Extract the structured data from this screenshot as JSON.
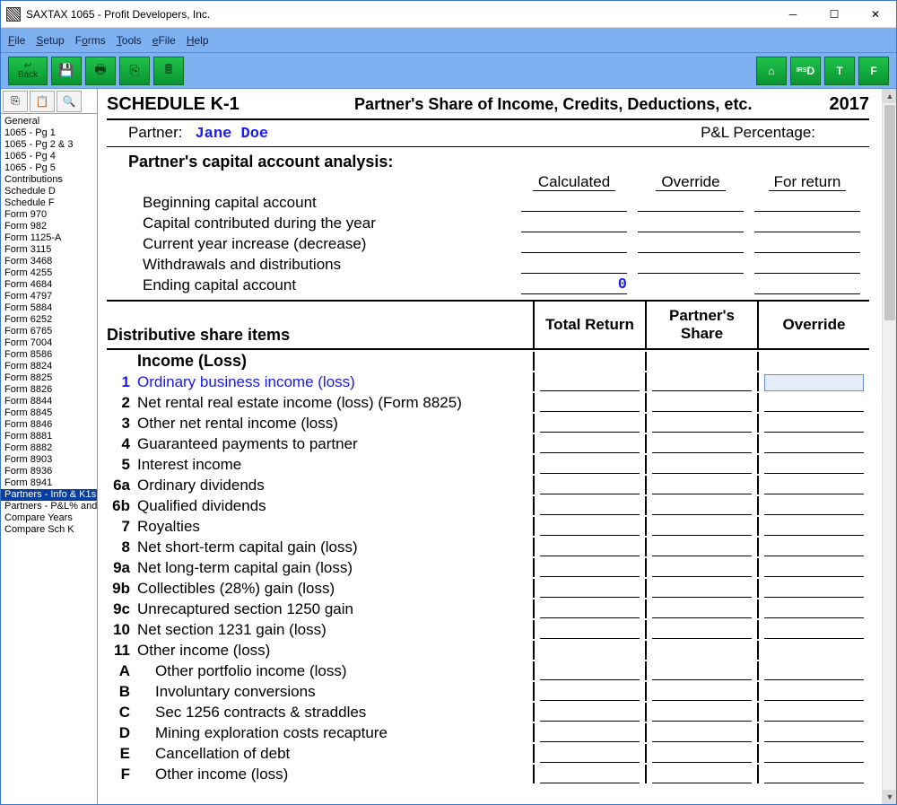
{
  "window": {
    "title": "SAXTAX 1065 - Profit Developers, Inc."
  },
  "menu": {
    "file": "File",
    "setup": "Setup",
    "forms": "Forms",
    "tools": "Tools",
    "efile": "eFile",
    "help": "Help"
  },
  "toolbar": {
    "back": "Back"
  },
  "irs": {
    "home": "⌂",
    "d": "D",
    "t": "T",
    "f": "F",
    "irs": "IRS"
  },
  "sidebar": {
    "items": [
      "General",
      "1065 - Pg 1",
      "1065 - Pg 2 & 3",
      "1065 - Pg 4",
      "1065 - Pg 5",
      "Contributions",
      "Schedule D",
      "Schedule F",
      "Form 970",
      "Form 982",
      "Form 1125-A",
      "Form 3115",
      "Form 3468",
      "Form 4255",
      "Form 4684",
      "Form 4797",
      "Form 5884",
      "Form 6252",
      "Form 6765",
      "Form 7004",
      "Form 8586",
      "Form 8824",
      "Form 8825",
      "Form 8826",
      "Form 8844",
      "Form 8845",
      "Form 8846",
      "Form 8881",
      "Form 8882",
      "Form 8903",
      "Form 8936",
      "Form 8941",
      "Partners - Info & K1s",
      "Partners - P&L% and",
      "Compare Years",
      "Compare Sch K"
    ],
    "selectedIndex": 32
  },
  "form": {
    "schedule": "SCHEDULE K-1",
    "subtitle": "Partner's Share of Income, Credits, Deductions, etc.",
    "year": "2017",
    "partner_label": "Partner:",
    "partner_name": "Jane Doe",
    "pl_pct_label": "P&L Percentage:",
    "cap_title": "Partner's capital account analysis:",
    "cap_cols": {
      "c1": "Calculated",
      "c2": "Override",
      "c3": "For return"
    },
    "cap_rows": {
      "r1": "Beginning capital account",
      "r2": "Capital contributed during the year",
      "r3": "Current year increase (decrease)",
      "r4": "Withdrawals and distributions",
      "r5": "Ending capital account"
    },
    "cap_vals": {
      "ending_calc": "0"
    },
    "dist_title": "Distributive share items",
    "dist_cols": {
      "c1": "Total Return",
      "c2": "Partner's Share",
      "c3": "Override"
    },
    "income_heading": "Income (Loss)",
    "lines": {
      "l1": {
        "n": "1",
        "t": "Ordinary business income (loss)"
      },
      "l2": {
        "n": "2",
        "t": "Net rental real estate income (loss) (Form 8825)"
      },
      "l3": {
        "n": "3",
        "t": "Other net rental income (loss)"
      },
      "l4": {
        "n": "4",
        "t": "Guaranteed payments to partner"
      },
      "l5": {
        "n": "5",
        "t": "Interest income"
      },
      "l6a": {
        "n": "6a",
        "t": "Ordinary dividends"
      },
      "l6b": {
        "n": "6b",
        "t": "Qualified dividends"
      },
      "l7": {
        "n": "7",
        "t": "Royalties"
      },
      "l8": {
        "n": "8",
        "t": "Net short-term capital gain (loss)"
      },
      "l9a": {
        "n": "9a",
        "t": "Net long-term capital gain (loss)"
      },
      "l9b": {
        "n": "9b",
        "t": "Collectibles (28%) gain (loss)"
      },
      "l9c": {
        "n": "9c",
        "t": "Unrecaptured section 1250 gain"
      },
      "l10": {
        "n": "10",
        "t": "Net section 1231 gain (loss)"
      },
      "l11": {
        "n": "11",
        "t": "Other income (loss)"
      },
      "l11a": {
        "n": "A",
        "t": "Other portfolio income (loss)"
      },
      "l11b": {
        "n": "B",
        "t": "Involuntary conversions"
      },
      "l11c": {
        "n": "C",
        "t": "Sec 1256 contracts & straddles"
      },
      "l11d": {
        "n": "D",
        "t": "Mining exploration costs recapture"
      },
      "l11e": {
        "n": "E",
        "t": "Cancellation of debt"
      },
      "l11f": {
        "n": "F",
        "t": "Other income (loss)"
      }
    }
  }
}
